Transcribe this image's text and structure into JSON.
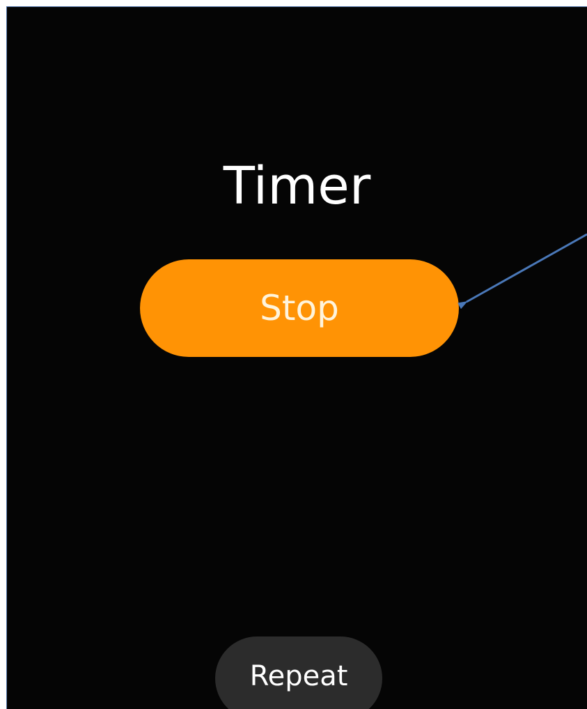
{
  "screen": {
    "title": "Timer"
  },
  "actions": {
    "stop_label": "Stop",
    "repeat_label": "Repeat"
  },
  "colors": {
    "background": "#050505",
    "stop_button": "#ff9305",
    "repeat_button": "#2c2c2c",
    "annotation_arrow": "#4a78b8"
  },
  "annotation": {
    "icon": "arrow-icon",
    "target": "stop-button"
  }
}
